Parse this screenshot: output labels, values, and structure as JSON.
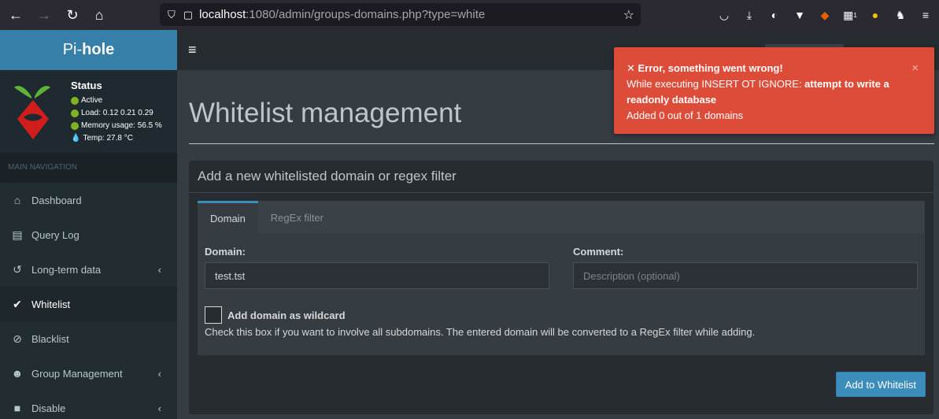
{
  "browser": {
    "url_host": "localhost",
    "url_path": ":1080/admin/groups-domains.php?type=white",
    "buttons": [
      "back-icon",
      "forward-icon",
      "reload-icon",
      "home-icon"
    ],
    "extension_badge": "1"
  },
  "brand": {
    "prefix": "Pi-",
    "bold": "hole"
  },
  "status": {
    "title": "Status",
    "active": "Active",
    "load": "Load:  0.12  0.21  0.29",
    "memory": "Memory usage:  56.5 %",
    "temp": "Temp: 27.8 °C"
  },
  "sidebar": {
    "header": "MAIN NAVIGATION",
    "items": [
      {
        "label": "Dashboard",
        "icon": "home-icon"
      },
      {
        "label": "Query Log",
        "icon": "file-icon"
      },
      {
        "label": "Long-term data",
        "icon": "history-icon",
        "chevron": "‹"
      },
      {
        "label": "Whitelist",
        "icon": "check-circle-icon"
      },
      {
        "label": "Blacklist",
        "icon": "ban-icon"
      },
      {
        "label": "Group Management",
        "icon": "users-icon",
        "chevron": "‹"
      },
      {
        "label": "Disable",
        "icon": "stop-icon",
        "chevron": "‹"
      }
    ]
  },
  "page": {
    "title": "Whitelist management",
    "box_title": "Add a new whitelisted domain or regex filter",
    "tabs": [
      "Domain",
      "RegEx filter"
    ],
    "domain_label": "Domain:",
    "domain_value": "test.tst",
    "comment_label": "Comment:",
    "comment_placeholder": "Description (optional)",
    "wildcard_label": "Add domain as wildcard",
    "wildcard_help": "Check this box if you want to involve all subdomains. The entered domain will be converted to a RegEx filter while adding.",
    "add_button": "Add to Whitelist"
  },
  "toast": {
    "title": "Error, something went wrong!",
    "line1_prefix": "While executing INSERT OT IGNORE: ",
    "line1_bold": "attempt to write a readonly database",
    "line2": "Added 0 out of 1 domains",
    "close": "×"
  },
  "colors": {
    "accent": "#3c8dbc",
    "error": "#dd4b39",
    "active_dot": "#7fb321"
  }
}
